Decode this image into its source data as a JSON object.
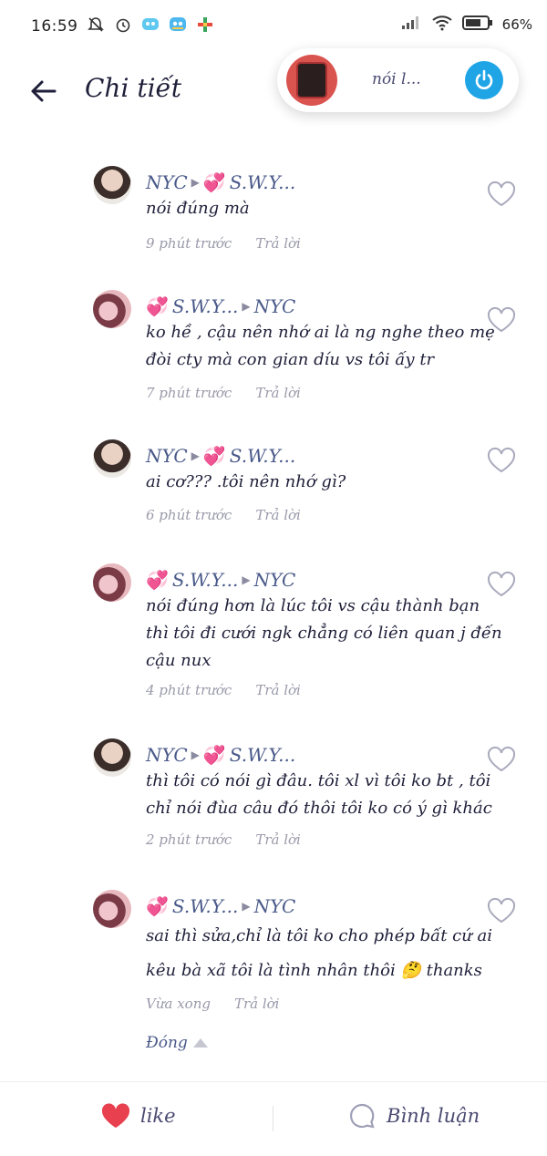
{
  "status_bar": {
    "time": "16:59",
    "battery": "66%"
  },
  "header": {
    "title": "Chi tiết"
  },
  "music_pill": {
    "text": "nói l..."
  },
  "comments": [
    {
      "author": "NYC",
      "reply_to": "S.W.Y...",
      "text_lines": [
        "nói đúng mà"
      ],
      "time": "9 phút trước",
      "reply": "Trả lời"
    },
    {
      "author": "S.W.Y...",
      "reply_to": "NYC",
      "text_lines": [
        "ko hề , cậu nên nhớ ai là ng nghe theo mẹ",
        "đòi cty mà con gian díu vs tôi ấy tr"
      ],
      "time": "7 phút trước",
      "reply": "Trả lời"
    },
    {
      "author": "NYC",
      "reply_to": "S.W.Y...",
      "text_lines": [
        "ai cơ??? .tôi nên nhớ gì?"
      ],
      "time": "6 phút trước",
      "reply": "Trả lời"
    },
    {
      "author": "S.W.Y...",
      "reply_to": "NYC",
      "text_lines": [
        "nói đúng hơn là lúc tôi vs cậu thành bạn",
        "thì tôi đi cưới ngk chẳng có liên quan j đến",
        "cậu nux"
      ],
      "time": "4 phút trước",
      "reply": "Trả lời"
    },
    {
      "author": "NYC",
      "reply_to": "S.W.Y...",
      "text_lines": [
        "thì tôi có nói gì đâu. tôi xl vì tôi ko bt , tôi",
        "chỉ nói đùa câu đó thôi tôi ko có ý gì khác"
      ],
      "time": "2 phút trước",
      "reply": "Trả lời"
    },
    {
      "author": "S.W.Y...",
      "reply_to": "NYC",
      "text_lines": [
        "sai thì sửa,chỉ là tôi ko cho phép bất cứ ai",
        "kêu bà xã tôi là tình nhân thôi 🤔 thanks"
      ],
      "time": "Vừa xong",
      "reply": "Trả lời"
    }
  ],
  "close_label": "Đóng",
  "bottom_bar": {
    "like_label": "like",
    "comment_label": "Bình luận"
  },
  "colors": {
    "accent_blue": "#1fa5e6",
    "heart_red": "#e8404f",
    "name_blue": "#4a5a8a"
  }
}
